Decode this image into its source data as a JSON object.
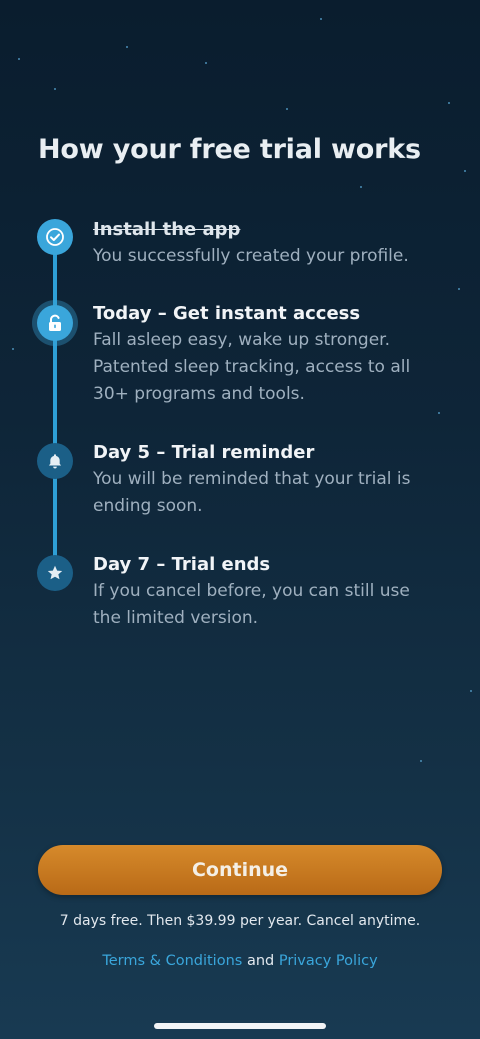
{
  "page": {
    "title": "How your free trial works"
  },
  "steps": [
    {
      "title": "Install the app",
      "description": "You successfully created your profile.",
      "state": "completed",
      "icon": "check-icon"
    },
    {
      "title": "Today – Get instant access",
      "description": "Fall asleep easy, wake up stronger. Patented sleep tracking, access to all 30+ programs and tools.",
      "state": "current",
      "icon": "unlock-icon"
    },
    {
      "title": "Day 5 – Trial reminder",
      "description": "You will be reminded that your trial is ending soon.",
      "state": "upcoming",
      "icon": "bell-icon"
    },
    {
      "title": "Day 7 – Trial ends",
      "description": "If you cancel before, you can still use the limited version.",
      "state": "upcoming",
      "icon": "star-icon"
    }
  ],
  "cta": {
    "continue_label": "Continue"
  },
  "footer": {
    "pricing_text": "7 days free. Then $39.99 per year. Cancel anytime.",
    "terms_label": "Terms & Conditions",
    "and_text": "and",
    "privacy_label": "Privacy Policy"
  },
  "colors": {
    "accent": "#3aa6db",
    "button": "#c97a22",
    "background_top": "#0a1d2e",
    "background_bottom": "#183a52"
  }
}
